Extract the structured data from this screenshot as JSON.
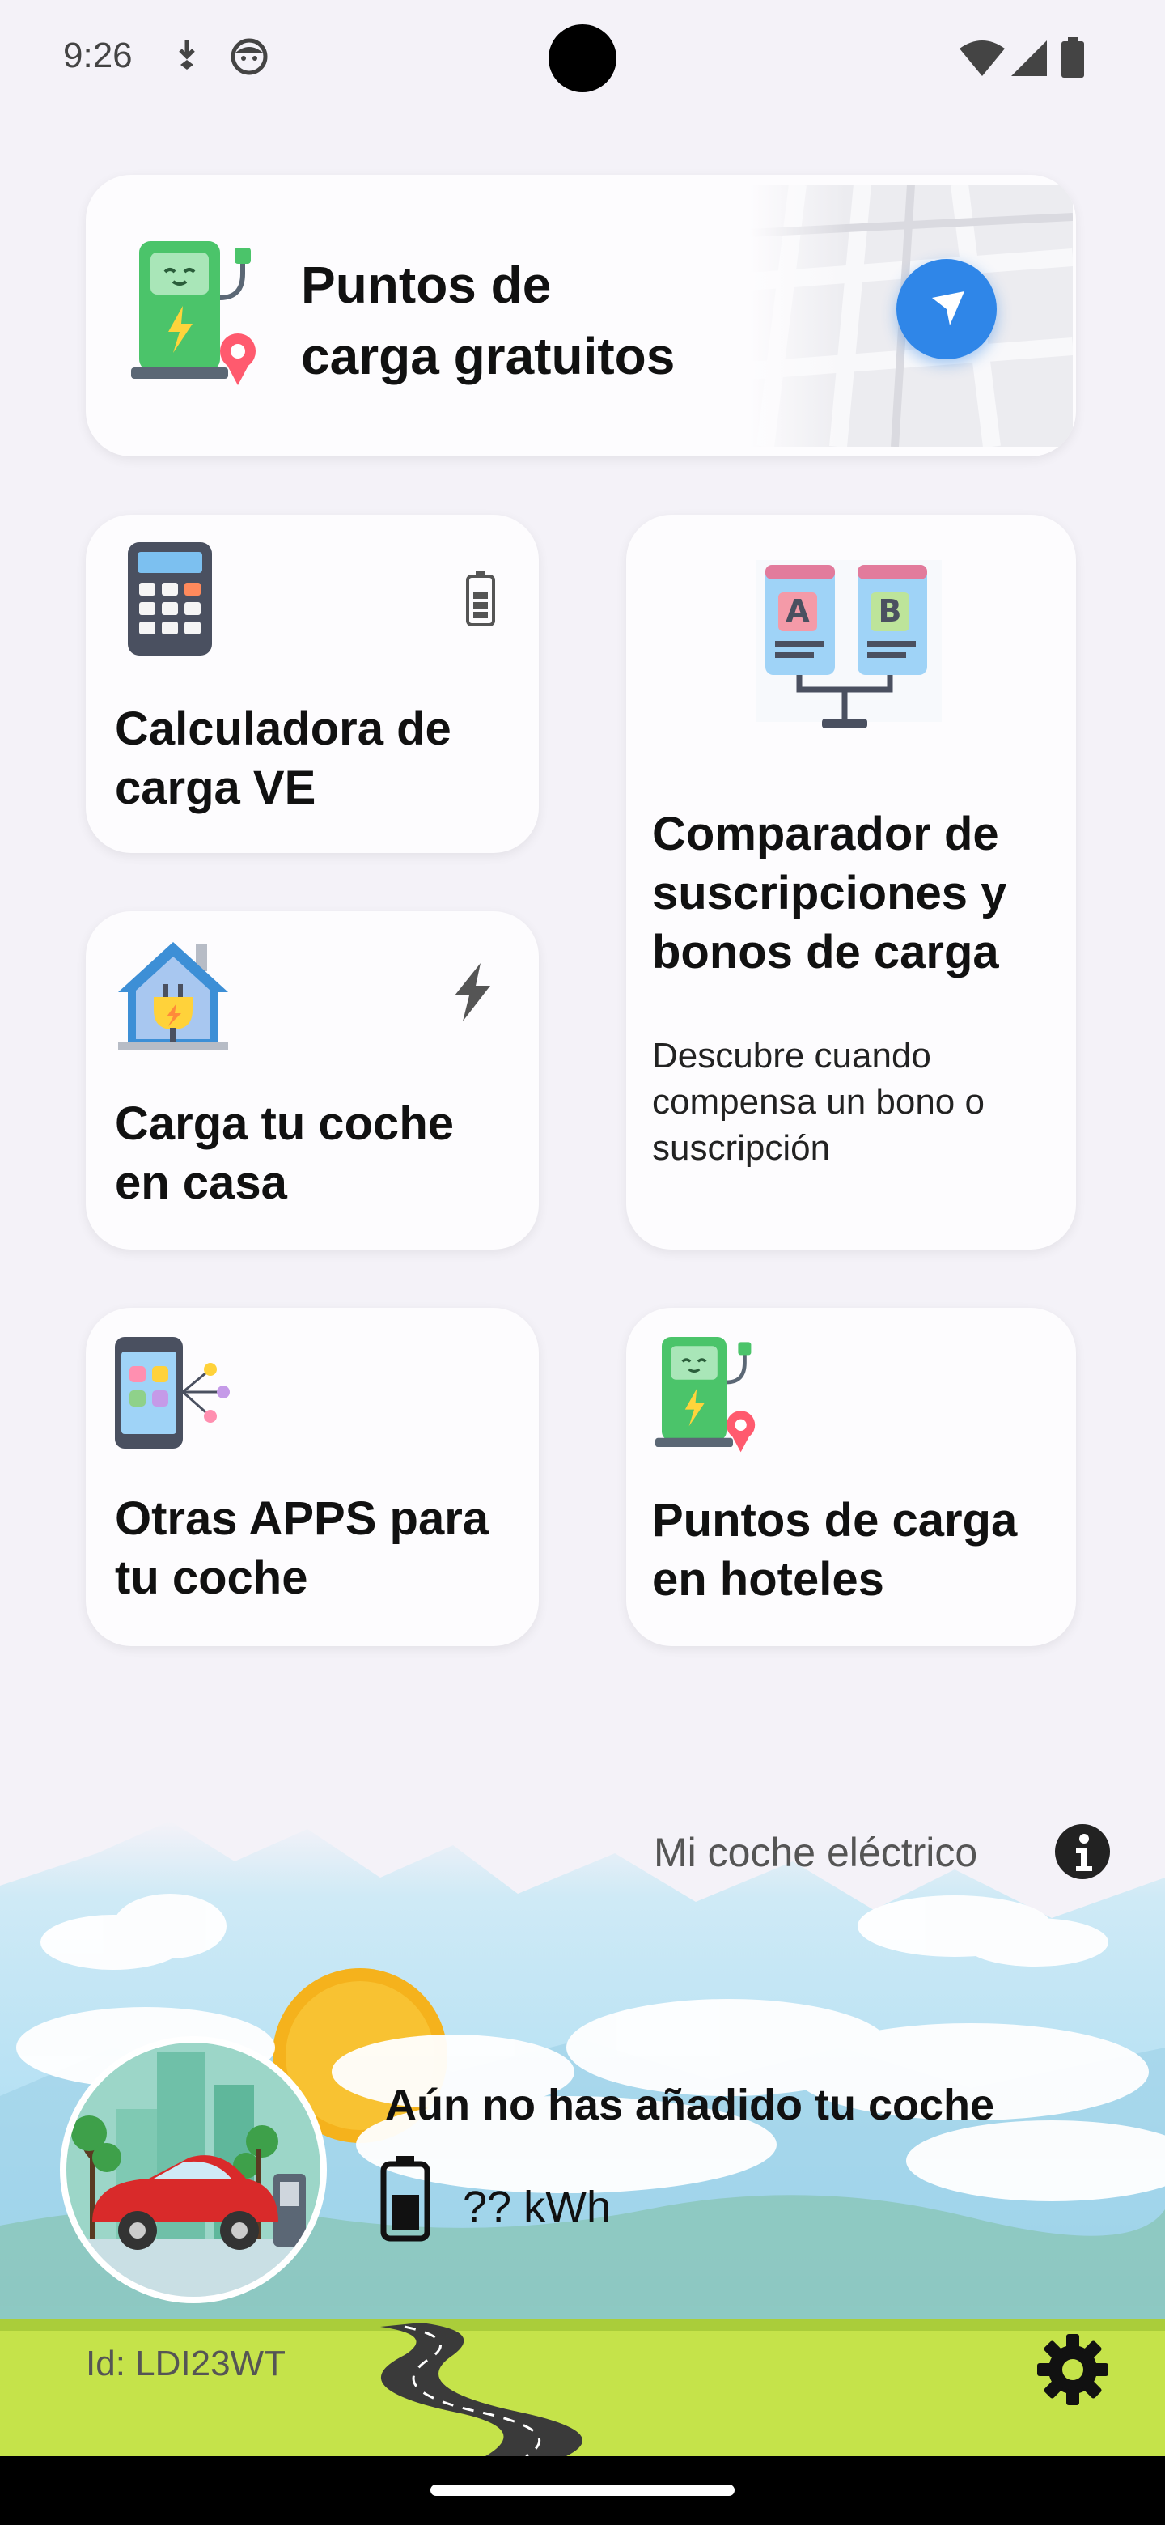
{
  "status_bar": {
    "time": "9:26"
  },
  "cards": {
    "free_points": {
      "title": "Puntos de carga gratuitos",
      "line1": "Puntos de",
      "line2": "carga gratuitos"
    },
    "calculator": {
      "line1": "Calculadora de",
      "line2": "carga VE"
    },
    "comparator": {
      "line1": "Comparador de",
      "line2": "suscripciones y",
      "line3": "bonos de carga",
      "desc1": "Descubre cuando",
      "desc2": "compensa un bono o",
      "desc3": "suscripción"
    },
    "home_charge": {
      "line1": "Carga tu coche",
      "line2": "en casa"
    },
    "other_apps": {
      "line1": "Otras APPS para",
      "line2": "tu coche"
    },
    "hotels": {
      "line1": "Puntos de carga",
      "line2": "en hoteles"
    }
  },
  "my_car": {
    "section_label": "Mi coche eléctrico",
    "no_car_text": "Aún no has añadido tu coche",
    "energy": "?? kWh",
    "id_label": "Id: LDI23WT"
  },
  "icons": {
    "status": [
      "download-icon",
      "face-icon",
      "wifi-icon",
      "signal-icon",
      "battery-icon"
    ],
    "cards": [
      "charging-station-icon",
      "navigation-arrow-icon",
      "calculator-icon",
      "battery-small-icon",
      "compare-ab-icon",
      "house-plug-icon",
      "lightning-icon",
      "apps-phone-icon",
      "hotel-charging-icon"
    ],
    "bottom": [
      "info-icon",
      "car-avatar-icon",
      "battery-level-icon",
      "gear-icon"
    ]
  },
  "colors": {
    "background": "#f4f2f8",
    "card": "#fdfcfe",
    "accent_blue": "#2f86e8",
    "grass": "#c5e34a",
    "sky": "#bfe6f5"
  }
}
